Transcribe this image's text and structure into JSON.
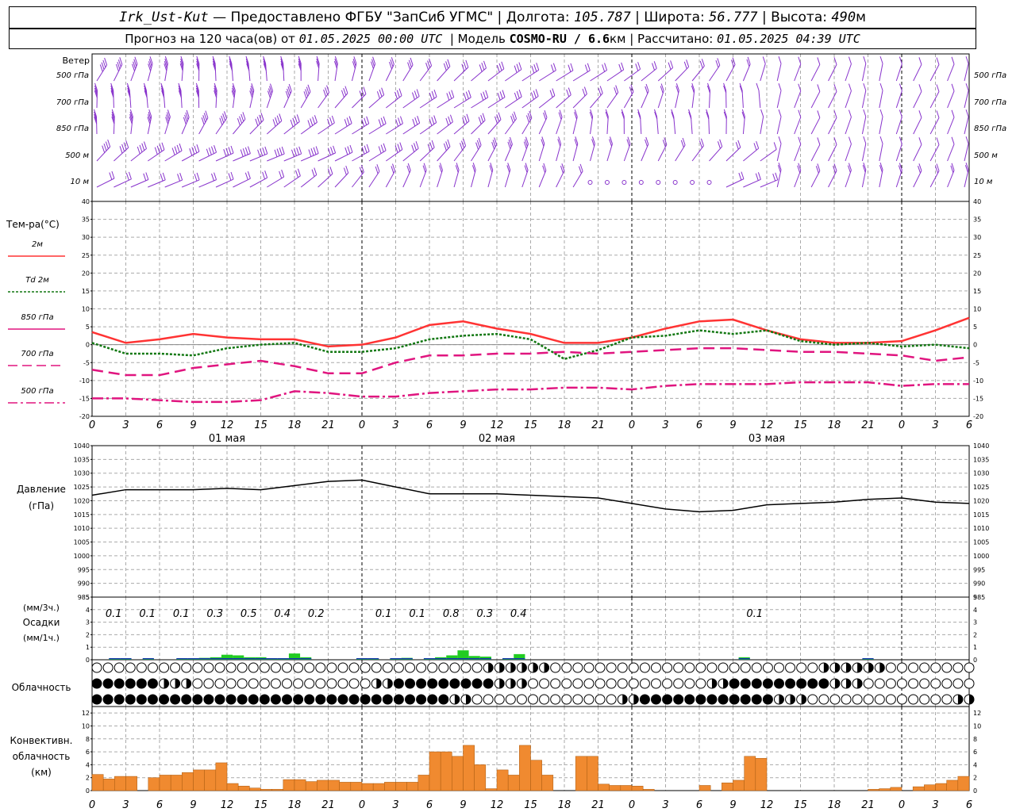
{
  "header": {
    "station": "Irk_Ust-Kut",
    "provider": "— Предоставлено ФГБУ \"ЗапСиб УГМС\"",
    "lon_label": "Долгота:",
    "lon": "105.787",
    "lat_label": "Широта:",
    "lat": "56.777",
    "alt_label": "Высота:",
    "alt": "490",
    "alt_unit": "м",
    "forecast_prefix": "Прогноз на 120 часа(ов) от",
    "forecast_start": "01.05.2025 00:00 UTC",
    "model_label": "Модель",
    "model": "COSMO-RU / 6.6",
    "model_unit": "км",
    "calc_label": "Рассчитано:",
    "calc_time": "01.05.2025 04:39 UTC"
  },
  "wind": {
    "title": "Ветер",
    "levels": [
      "500 гПа",
      "700 гПа",
      "850 гПа",
      "500 м",
      "10 м"
    ]
  },
  "temperature": {
    "title": "Тем-ра(°C)",
    "legend": [
      {
        "label": "2м",
        "color": "#ff3333",
        "dash": "none"
      },
      {
        "label": "Td 2м",
        "color": "#117711",
        "dash": "3,2"
      },
      {
        "label": "850 гПа",
        "color": "#e0157f",
        "dash": "none"
      },
      {
        "label": "700 гПа",
        "color": "#e0157f",
        "dash": "12,6"
      },
      {
        "label": "500 гПа",
        "color": "#e0157f",
        "dash": "12,4,3,4"
      }
    ]
  },
  "pressure": {
    "title": "Давление",
    "unit": "(гПа)"
  },
  "precip": {
    "unit3": "(мм/3ч.)",
    "title": "Осадки",
    "unit1": "(мм/1ч.)"
  },
  "cloud": {
    "title": "Облачность"
  },
  "convective": {
    "title1": "Конвективн.",
    "title2": "облачность",
    "unit": "(км)"
  },
  "time_axis": {
    "hour_labels": [
      "0",
      "3",
      "6",
      "9",
      "12",
      "15",
      "18",
      "21",
      "0",
      "3",
      "6",
      "9",
      "12",
      "15",
      "18",
      "21",
      "0",
      "3",
      "6",
      "9",
      "12",
      "15",
      "18",
      "21",
      "0",
      "3",
      "6"
    ],
    "day_labels": [
      "01 мая",
      "02 мая",
      "03 мая"
    ]
  },
  "chart_data": [
    {
      "type": "line",
      "name": "temperature",
      "x_hours": [
        0,
        3,
        6,
        9,
        12,
        15,
        18,
        21,
        24,
        27,
        30,
        33,
        36,
        39,
        42,
        45,
        48,
        51,
        54,
        57,
        60,
        63,
        66,
        69,
        72,
        75,
        78
      ],
      "ylim": [
        -20,
        40
      ],
      "yticks": [
        -20,
        -15,
        -10,
        -5,
        0,
        5,
        10,
        15,
        20,
        25,
        30,
        35,
        40
      ],
      "series": [
        {
          "name": "2м",
          "values": [
            3.5,
            0.5,
            1.5,
            3,
            2,
            1.5,
            1.5,
            -0.5,
            0,
            2,
            5.5,
            6.5,
            4.5,
            3,
            0.5,
            0.5,
            2,
            4.5,
            6.5,
            7,
            4,
            1.5,
            0.5,
            0.5,
            1,
            4,
            7.5
          ]
        },
        {
          "name": "Td 2м",
          "values": [
            0.5,
            -2.5,
            -2.5,
            -3,
            -1,
            0,
            0.5,
            -2,
            -2,
            -1,
            1.5,
            2.5,
            3,
            1.5,
            -4,
            -1.5,
            2,
            2.5,
            4,
            3,
            4,
            1,
            0,
            0.5,
            -0.5,
            0,
            -1
          ]
        },
        {
          "name": "850 гПа",
          "values": [
            -7,
            -8.5,
            -8.5,
            -6.5,
            -5.5,
            -4.5,
            -6,
            -8,
            -8,
            -5,
            -3,
            -3,
            -2.5,
            -2.5,
            -2,
            -2.5,
            -2,
            -1.5,
            -1,
            -1,
            -1.5,
            -2,
            -2,
            -2.5,
            -3,
            -4.5,
            -3.5
          ]
        },
        {
          "name": "700 гПа",
          "values": [
            -15,
            -15,
            -15.5,
            -16,
            -16,
            -15.5,
            -13,
            -13.5,
            -14.5,
            -14.5,
            -13.5,
            -13,
            -12.5,
            -12.5,
            -12,
            -12,
            -12.5,
            -11.5,
            -11,
            -11,
            -11,
            -10.5,
            -10.5,
            -10.5,
            -11.5,
            -11,
            -11
          ]
        }
      ]
    },
    {
      "type": "line",
      "name": "pressure",
      "x_hours": [
        0,
        3,
        6,
        9,
        12,
        15,
        18,
        21,
        24,
        27,
        30,
        33,
        36,
        39,
        42,
        45,
        48,
        51,
        54,
        57,
        60,
        63,
        66,
        69,
        72,
        75,
        78
      ],
      "ylim": [
        985,
        1040
      ],
      "yticks": [
        985,
        990,
        995,
        1000,
        1005,
        1010,
        1015,
        1020,
        1025,
        1030,
        1035,
        1040
      ],
      "series": [
        {
          "name": "Давление",
          "values": [
            1022,
            1024,
            1024,
            1024,
            1024.5,
            1024,
            1025.5,
            1027,
            1027.5,
            1025,
            1022.5,
            1022.5,
            1022.5,
            1022,
            1021.5,
            1021,
            1019,
            1017,
            1016,
            1016.5,
            1018.5,
            1019,
            1019.5,
            1020.5,
            1021,
            1019.5,
            1019
          ]
        }
      ]
    },
    {
      "type": "bar",
      "name": "precipitation",
      "ylim": [
        0,
        5
      ],
      "yticks": [
        0,
        1,
        2,
        3,
        4,
        5
      ],
      "accum_3h": [
        {
          "hour": 1.5,
          "value": "0.1"
        },
        {
          "hour": 4.5,
          "value": "0.1"
        },
        {
          "hour": 7.5,
          "value": "0.1"
        },
        {
          "hour": 10.5,
          "value": "0.3"
        },
        {
          "hour": 13.5,
          "value": "0.5"
        },
        {
          "hour": 16.5,
          "value": "0.4"
        },
        {
          "hour": 19.5,
          "value": "0.2"
        },
        {
          "hour": 25.5,
          "value": "0.1"
        },
        {
          "hour": 28.5,
          "value": "0.1"
        },
        {
          "hour": 31.5,
          "value": "0.8"
        },
        {
          "hour": 34.5,
          "value": "0.3"
        },
        {
          "hour": 37.5,
          "value": "0.4"
        },
        {
          "hour": 58.5,
          "value": "0.1"
        }
      ],
      "hourly": [
        {
          "hour": 2,
          "value": 0.05
        },
        {
          "hour": 3,
          "value": 0.05
        },
        {
          "hour": 5,
          "value": 0.05
        },
        {
          "hour": 8,
          "value": 0.05
        },
        {
          "hour": 9,
          "value": 0.1
        },
        {
          "hour": 10,
          "value": 0.15
        },
        {
          "hour": 11,
          "value": 0.2
        },
        {
          "hour": 12,
          "value": 0.4
        },
        {
          "hour": 13,
          "value": 0.35
        },
        {
          "hour": 14,
          "value": 0.2
        },
        {
          "hour": 15,
          "value": 0.2
        },
        {
          "hour": 16,
          "value": 0.1
        },
        {
          "hour": 17,
          "value": 0.1
        },
        {
          "hour": 18,
          "value": 0.5
        },
        {
          "hour": 19,
          "value": 0.2
        },
        {
          "hour": 24,
          "value": 0.05
        },
        {
          "hour": 25,
          "value": 0.05
        },
        {
          "hour": 27,
          "value": 0.1
        },
        {
          "hour": 28,
          "value": 0.15
        },
        {
          "hour": 30,
          "value": 0.1
        },
        {
          "hour": 31,
          "value": 0.2
        },
        {
          "hour": 32,
          "value": 0.35
        },
        {
          "hour": 33,
          "value": 0.75
        },
        {
          "hour": 34,
          "value": 0.3
        },
        {
          "hour": 35,
          "value": 0.25
        },
        {
          "hour": 37,
          "value": 0.1
        },
        {
          "hour": 38,
          "value": 0.45
        },
        {
          "hour": 58,
          "value": 0.2
        },
        {
          "hour": 69,
          "value": 0.05
        }
      ]
    },
    {
      "type": "bar",
      "name": "convective-cloud",
      "ylim": [
        0,
        13
      ],
      "yticks": [
        0,
        2,
        4,
        6,
        8,
        10,
        12
      ],
      "bars": [
        {
          "hour": 0.5,
          "value": 2.5
        },
        {
          "hour": 1.5,
          "value": 1.8
        },
        {
          "hour": 2.5,
          "value": 2.2
        },
        {
          "hour": 3.5,
          "value": 2.2
        },
        {
          "hour": 5.5,
          "value": 2.0
        },
        {
          "hour": 6.5,
          "value": 2.4
        },
        {
          "hour": 7.5,
          "value": 2.4
        },
        {
          "hour": 8.5,
          "value": 2.8
        },
        {
          "hour": 9.5,
          "value": 3.2
        },
        {
          "hour": 10.5,
          "value": 3.2
        },
        {
          "hour": 11.5,
          "value": 4.3
        },
        {
          "hour": 12.5,
          "value": 1.1
        },
        {
          "hour": 13.5,
          "value": 0.7
        },
        {
          "hour": 14.5,
          "value": 0.4
        },
        {
          "hour": 15.5,
          "value": 0.2
        },
        {
          "hour": 16.5,
          "value": 0.2
        },
        {
          "hour": 17.5,
          "value": 1.7
        },
        {
          "hour": 18.5,
          "value": 1.7
        },
        {
          "hour": 19.5,
          "value": 1.4
        },
        {
          "hour": 20.5,
          "value": 1.6
        },
        {
          "hour": 21.5,
          "value": 1.6
        },
        {
          "hour": 22.5,
          "value": 1.3
        },
        {
          "hour": 23.5,
          "value": 1.3
        },
        {
          "hour": 24.5,
          "value": 1.1
        },
        {
          "hour": 25.5,
          "value": 1.1
        },
        {
          "hour": 26.5,
          "value": 1.3
        },
        {
          "hour": 27.5,
          "value": 1.3
        },
        {
          "hour": 28.5,
          "value": 1.3
        },
        {
          "hour": 29.5,
          "value": 2.4
        },
        {
          "hour": 30.5,
          "value": 6.0
        },
        {
          "hour": 31.5,
          "value": 6.0
        },
        {
          "hour": 32.5,
          "value": 5.3
        },
        {
          "hour": 33.5,
          "value": 7.0
        },
        {
          "hour": 34.5,
          "value": 4.0
        },
        {
          "hour": 35.5,
          "value": 0.3
        },
        {
          "hour": 36.5,
          "value": 3.2
        },
        {
          "hour": 37.5,
          "value": 2.4
        },
        {
          "hour": 38.5,
          "value": 7.0
        },
        {
          "hour": 39.5,
          "value": 4.7
        },
        {
          "hour": 40.5,
          "value": 2.4
        },
        {
          "hour": 43.5,
          "value": 5.3
        },
        {
          "hour": 44.5,
          "value": 5.3
        },
        {
          "hour": 45.5,
          "value": 1.0
        },
        {
          "hour": 46.5,
          "value": 0.8
        },
        {
          "hour": 47.5,
          "value": 0.8
        },
        {
          "hour": 48.5,
          "value": 0.7
        },
        {
          "hour": 49.5,
          "value": 0.2
        },
        {
          "hour": 54.5,
          "value": 0.8
        },
        {
          "hour": 56.5,
          "value": 1.2
        },
        {
          "hour": 57.5,
          "value": 1.6
        },
        {
          "hour": 58.5,
          "value": 5.3
        },
        {
          "hour": 59.5,
          "value": 5.0
        },
        {
          "hour": 69.5,
          "value": 0.2
        },
        {
          "hour": 70.5,
          "value": 0.3
        },
        {
          "hour": 71.5,
          "value": 0.5
        },
        {
          "hour": 73.5,
          "value": 0.6
        },
        {
          "hour": 74.5,
          "value": 0.9
        },
        {
          "hour": 75.5,
          "value": 1.1
        },
        {
          "hour": 76.5,
          "value": 1.6
        },
        {
          "hour": 77.5,
          "value": 2.2
        },
        {
          "hour": 78.5,
          "value": 2.4
        }
      ]
    }
  ],
  "colors": {
    "wind_barb": "#8833cc",
    "precip_green": "#22cc22",
    "precip_blue": "#1133aa",
    "convective": "#f08a30",
    "grid": "#aaaaaa",
    "pressure": "#000000"
  }
}
